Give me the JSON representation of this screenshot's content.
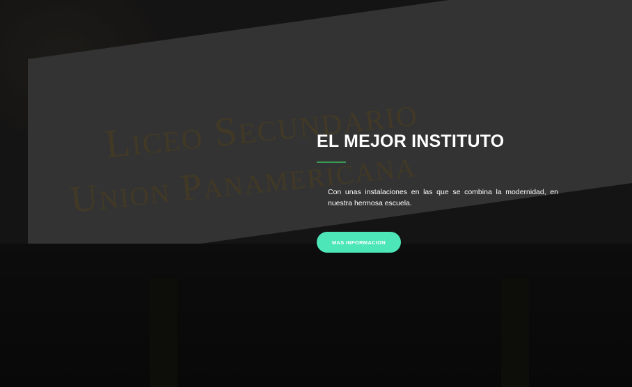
{
  "background": {
    "sign_line1": "Liceo Secundario",
    "sign_line2": "Union Panamericana"
  },
  "hero": {
    "title": "EL MEJOR INSTITUTO",
    "description": "Con unas instalaciones en las que se combina la modernidad, en nuestra hermosa escuela.",
    "button_label": "MAS INFORMACION",
    "accent_color": "#4de6b8",
    "divider_color": "#3a9a55"
  }
}
